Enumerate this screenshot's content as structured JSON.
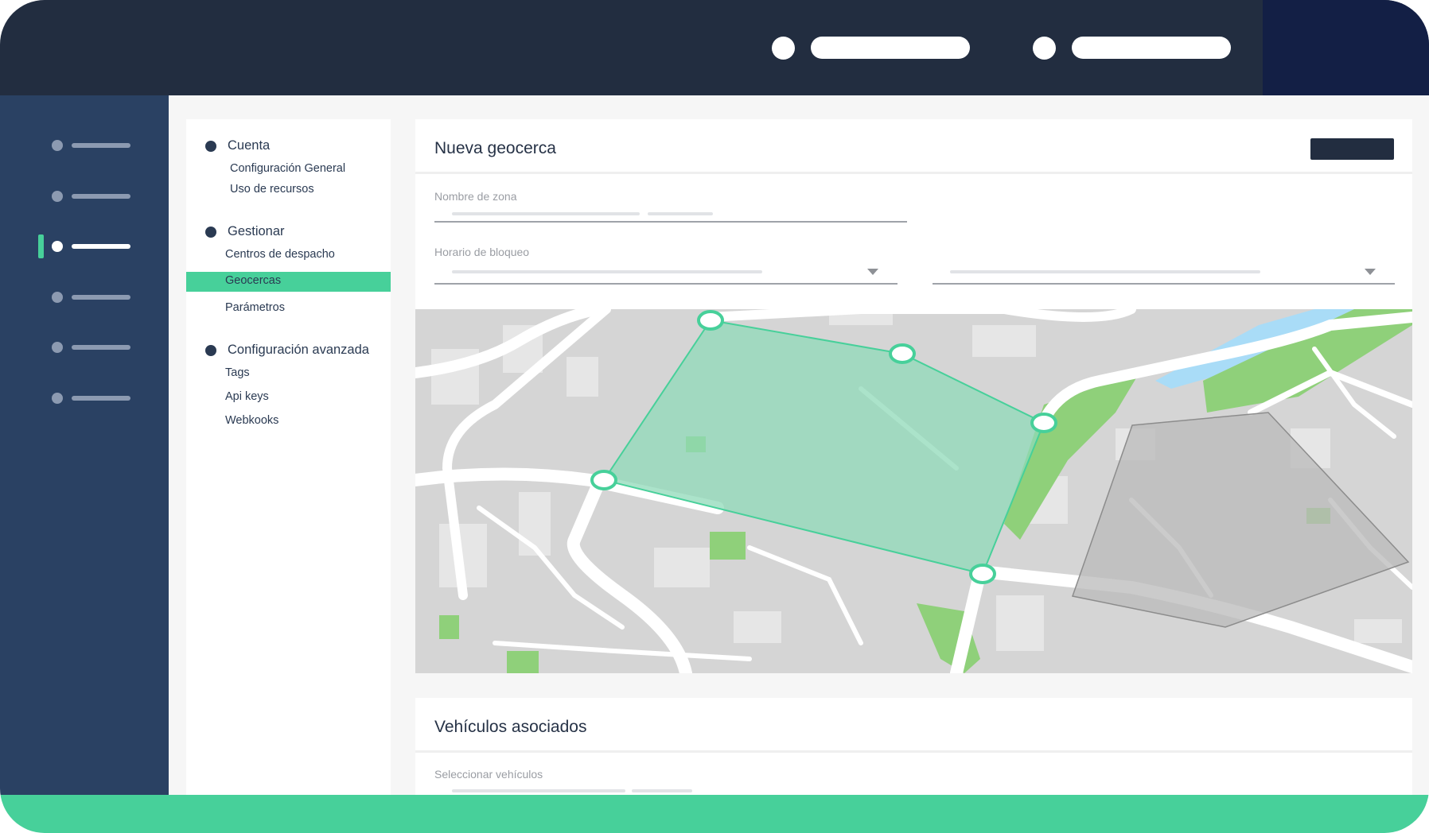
{
  "nav": {
    "sections": [
      {
        "title": "Cuenta",
        "items": [
          "Configuración General",
          "Uso de recursos"
        ]
      },
      {
        "title": "Gestionar",
        "items": [
          "Centros de despacho",
          "Geocercas",
          "Parámetros"
        ]
      },
      {
        "title": "Configuración avanzada",
        "items": [
          "Tags",
          "Api keys",
          "Webkooks"
        ]
      }
    ],
    "active_item": "Geocercas"
  },
  "geofence_form": {
    "title": "Nueva geocerca",
    "zone_name_label": "Nombre de zona",
    "schedule_label": "Horario de bloqueo"
  },
  "vehicles": {
    "title": "Vehículos asociados",
    "select_label": "Seleccionar vehículos"
  },
  "colors": {
    "topbar": "#222d40",
    "rail": "#2a4163",
    "accent": "#47d09a",
    "geofence_fill": "#8fd9b8",
    "geofence_stroke": "#47d09a"
  },
  "icons": {
    "caret": "chevron-down-icon",
    "vertex": "map-vertex-handle"
  }
}
